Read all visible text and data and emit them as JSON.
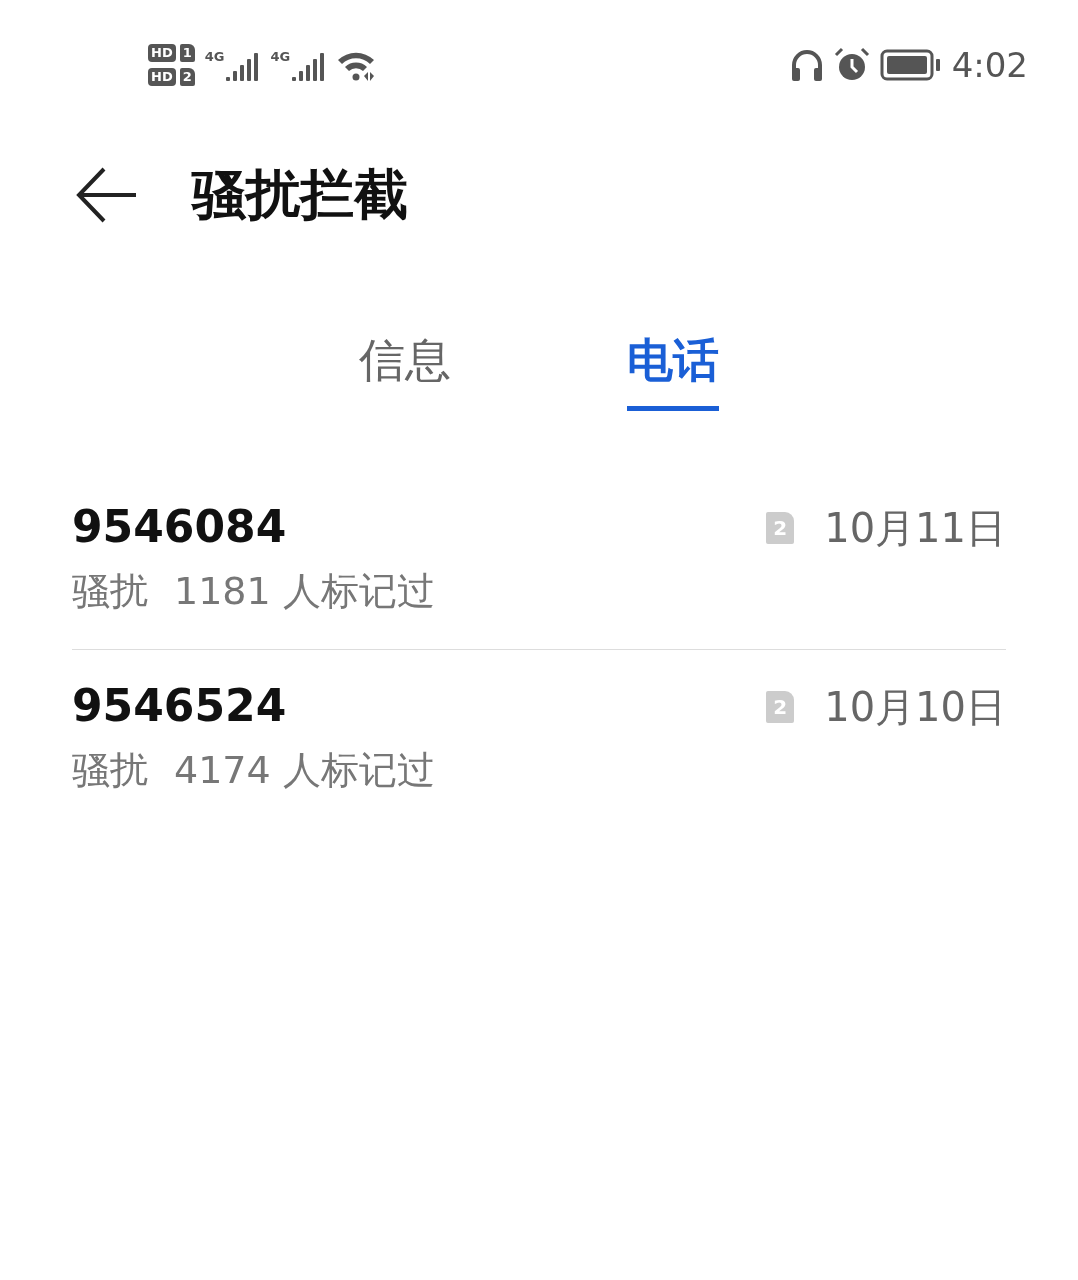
{
  "status_bar": {
    "sims": [
      {
        "hd": "HD",
        "slot": "1"
      },
      {
        "hd": "HD",
        "slot": "2"
      }
    ],
    "networks": [
      {
        "type": "4G"
      },
      {
        "type": "4G"
      }
    ],
    "time": "4:02"
  },
  "header": {
    "title": "骚扰拦截"
  },
  "tabs": [
    {
      "label": "信息",
      "selected": false
    },
    {
      "label": "电话",
      "selected": true
    }
  ],
  "calls": [
    {
      "number": "9546084",
      "tag": "骚扰",
      "count": "1181 人标记过",
      "sim": "2",
      "date": "10月11日"
    },
    {
      "number": "9546524",
      "tag": "骚扰",
      "count": "4174 人标记过",
      "sim": "2",
      "date": "10月10日"
    }
  ]
}
